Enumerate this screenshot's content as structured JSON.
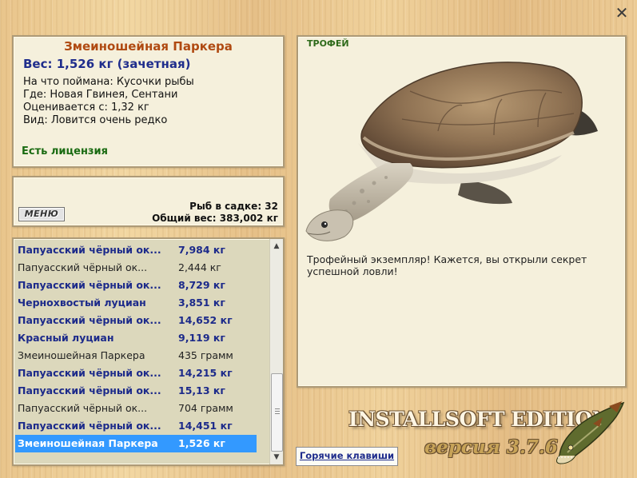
{
  "fish": {
    "name": "Змеиношейная Паркера",
    "weight": "Вес: 1,526 кг (зачетная)",
    "bait": "На что поймана: Кусочки рыбы",
    "place": "Где: Новая Гвинея, Сентани",
    "valued": "Оценивается с: 1,32 кг",
    "kind": "Вид: Ловится очень редко",
    "license": "Есть лицензия"
  },
  "summary": {
    "menu_label": "МЕНЮ",
    "keepnet_count": "Рыб в садке: 32",
    "total_weight": "Общий вес: 383,002 кг"
  },
  "catch_list": [
    {
      "name": "Папуасский чёрный ок...",
      "weight": "7,984 кг",
      "style": "bold"
    },
    {
      "name": "Папуасский чёрный ок...",
      "weight": "2,444 кг",
      "style": "norm"
    },
    {
      "name": "Папуасский чёрный ок...",
      "weight": "8,729 кг",
      "style": "bold"
    },
    {
      "name": "Чернохвостый луциан",
      "weight": "3,851 кг",
      "style": "bold"
    },
    {
      "name": "Папуасский чёрный ок...",
      "weight": "14,652 кг",
      "style": "bold"
    },
    {
      "name": "Красный луциан",
      "weight": "9,119 кг",
      "style": "bold"
    },
    {
      "name": "Змеиношейная Паркера",
      "weight": "435 грамм",
      "style": "norm"
    },
    {
      "name": "Папуасский чёрный ок...",
      "weight": "14,215 кг",
      "style": "bold"
    },
    {
      "name": "Папуасский чёрный ок...",
      "weight": "15,13 кг",
      "style": "bold"
    },
    {
      "name": "Папуасский чёрный ок...",
      "weight": "704 грамм",
      "style": "norm"
    },
    {
      "name": "Папуасский чёрный ок...",
      "weight": "14,451 кг",
      "style": "bold"
    },
    {
      "name": "Змеиношейная Паркера",
      "weight": "1,526 кг",
      "style": "sel"
    }
  ],
  "detail": {
    "badge": "ТРОФЕЙ",
    "description": "Трофейный экземпляр! Кажется, вы открыли секрет успешной ловли!"
  },
  "hotkeys_label": "Горячие клавиши",
  "logo": {
    "title": "INSTALLSOFT EDITION",
    "version": "версия 3.7.6"
  },
  "icons": {
    "close": "close-icon",
    "pike": "pike-logo-icon",
    "turtle": "turtle-image"
  },
  "colors": {
    "selection": "#3399ff",
    "title": "#b04a12",
    "weight_text": "#1f2d8c",
    "license_text": "#1a6b12"
  }
}
